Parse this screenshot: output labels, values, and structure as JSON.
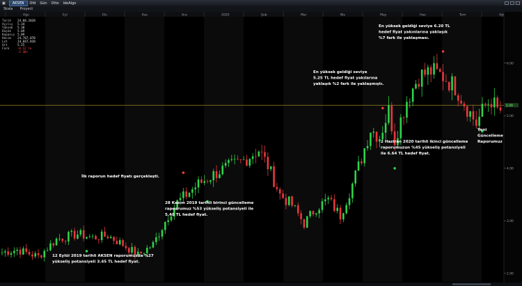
{
  "toolbar": {
    "symbol": "AKSEN",
    "items": [
      "Ofd",
      "Gün",
      "Otto",
      "IdeAlgo"
    ]
  },
  "menubar": {
    "items": [
      "Skala",
      "Proyect"
    ]
  },
  "info_panel": [
    {
      "k": "Tarih",
      "v": "24.06.2020"
    },
    {
      "k": "Açılış",
      "v": "5.34"
    },
    {
      "k": "Yüksek",
      "v": "5.38"
    },
    {
      "k": "Düşük",
      "v": "5.09"
    },
    {
      "k": "Kapanış",
      "v": "5.09"
    },
    {
      "k": "Hacim",
      "v": "24,767,070"
    },
    {
      "k": "Lot",
      "v": "14,667,820"
    },
    {
      "k": "Ort",
      "v": "5.25"
    },
    {
      "k": "Fark",
      "v": "-0.12 (% -2.30)",
      "neg": true
    }
  ],
  "colors": {
    "up": "#2fd34a",
    "down": "#e8383c",
    "ref": "#b8a02a",
    "annotation": "#ffffff",
    "bg": "#000000",
    "band": "#0b0b0b"
  },
  "chart_data": {
    "type": "candlestick",
    "x_months": [
      "Ağu",
      "Eyl",
      "Ekı",
      "Kas",
      "Ara",
      "2020",
      "Şub",
      "Mar",
      "Nis",
      "May",
      "Haz",
      "Tem",
      "Ağu"
    ],
    "y_ticks": [
      2.0,
      3.0,
      4.0,
      5.0,
      6.0
    ],
    "ylim": [
      1.84,
      6.95
    ],
    "last_price": "5.09",
    "ref_level": 5.2,
    "close_path": [
      [
        0,
        2.4
      ],
      [
        5,
        2.45
      ],
      [
        12,
        2.32
      ],
      [
        18,
        2.65
      ],
      [
        25,
        2.75
      ],
      [
        30,
        2.68
      ],
      [
        35,
        2.72
      ],
      [
        40,
        2.55
      ],
      [
        45,
        2.35
      ],
      [
        50,
        2.55
      ],
      [
        55,
        3.1
      ],
      [
        58,
        3.35
      ],
      [
        62,
        3.55
      ],
      [
        65,
        3.7
      ],
      [
        72,
        3.95
      ],
      [
        80,
        4.15
      ],
      [
        85,
        4.35
      ],
      [
        88,
        4.05
      ],
      [
        92,
        3.5
      ],
      [
        96,
        3.3
      ],
      [
        100,
        2.95
      ],
      [
        104,
        3.25
      ],
      [
        108,
        3.4
      ],
      [
        112,
        3.1
      ],
      [
        116,
        3.7
      ],
      [
        119,
        4.2
      ],
      [
        122,
        4.75
      ],
      [
        125,
        4.6
      ],
      [
        128,
        5.1
      ],
      [
        130,
        4.55
      ],
      [
        134,
        5.3
      ],
      [
        138,
        5.75
      ],
      [
        142,
        5.85
      ],
      [
        146,
        5.75
      ],
      [
        150,
        5.55
      ],
      [
        154,
        5.15
      ],
      [
        157,
        4.85
      ],
      [
        160,
        5.2
      ],
      [
        162,
        5.3
      ],
      [
        164,
        5.1
      ]
    ],
    "markers": [
      {
        "i": 28,
        "type": "buy"
      },
      {
        "i": 60,
        "type": "sell"
      },
      {
        "i": 68,
        "type": "buy"
      },
      {
        "i": 126,
        "type": "sell"
      },
      {
        "i": 130,
        "type": "buy"
      },
      {
        "i": 146,
        "type": "sell"
      },
      {
        "i": 159,
        "type": "buy"
      }
    ],
    "annotations": [
      {
        "lines": [
          "12 Eylül 2019 tarihli AKSEN raporumuzda %27",
          "yükseliş potansiyeli 3.45 TL hedef fiyat."
        ]
      },
      {
        "lines": [
          "İlk raporun hedef fiyatı gerçekleşti."
        ]
      },
      {
        "lines": [
          "28 Kasım 2019 tarihli birinci güncelleme",
          "rapoarumuz %53 yükseliş potansiyeli ile",
          "5.40 TL hedef fiyat."
        ]
      },
      {
        "lines": [
          "En yüksek geldiği seviye",
          "5.25 TL hedef fiyat yakılarına",
          "yaklaşık %2 fark ile yaklaşmıştı."
        ]
      },
      {
        "lines": [
          "En yüksek geldiği seviye 6.20 TL",
          "hedef fiyat yakınlarına yaklaşık",
          "%7 fark ile yaklaşması."
        ]
      },
      {
        "lines": [
          "2 Haziran 2020 tarihli ikinci güncelleme",
          "raporumuzun %45 yükseliş potansiyeli",
          "ile 6.64 TL hedef fiyat."
        ]
      },
      {
        "lines": [
          "Yeni",
          "Güncelleme",
          "Raporumuz"
        ]
      }
    ]
  }
}
